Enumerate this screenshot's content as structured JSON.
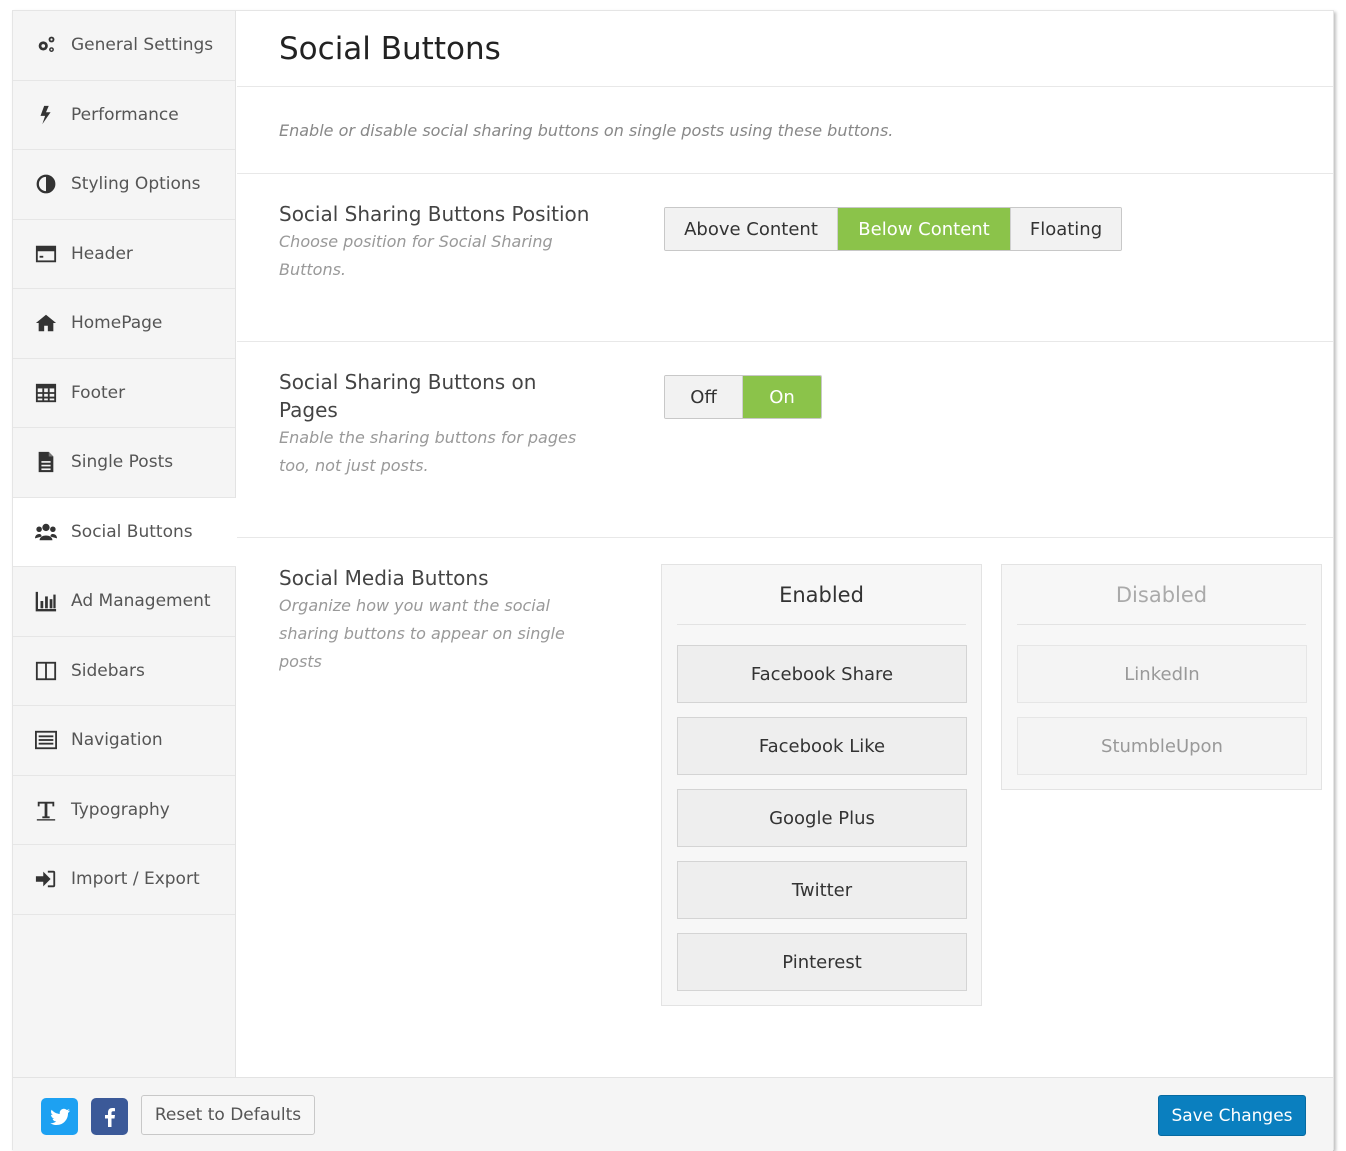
{
  "sidebar": {
    "items": [
      {
        "label": "General Settings",
        "icon": "gears-icon"
      },
      {
        "label": "Performance",
        "icon": "bolt-icon"
      },
      {
        "label": "Styling Options",
        "icon": "contrast-icon"
      },
      {
        "label": "Header",
        "icon": "header-icon"
      },
      {
        "label": "HomePage",
        "icon": "home-icon"
      },
      {
        "label": "Footer",
        "icon": "table-icon"
      },
      {
        "label": "Single Posts",
        "icon": "document-icon"
      },
      {
        "label": "Social Buttons",
        "icon": "users-icon",
        "active": true
      },
      {
        "label": "Ad Management",
        "icon": "bar-chart-icon"
      },
      {
        "label": "Sidebars",
        "icon": "columns-icon"
      },
      {
        "label": "Navigation",
        "icon": "list-icon"
      },
      {
        "label": "Typography",
        "icon": "text-icon"
      },
      {
        "label": "Import / Export",
        "icon": "sign-in-icon"
      }
    ]
  },
  "main": {
    "title": "Social Buttons",
    "description": "Enable or disable social sharing buttons on single posts using these buttons.",
    "position": {
      "label": "Social Sharing Buttons Position",
      "sublabel": "Choose position for Social Sharing Buttons.",
      "options": [
        "Above Content",
        "Below Content",
        "Floating"
      ],
      "selected": "Below Content"
    },
    "pages": {
      "label": "Social Sharing Buttons on Pages",
      "sublabel": "Enable the sharing buttons for pages too, not just posts.",
      "off_label": "Off",
      "on_label": "On",
      "selected": "On"
    },
    "media": {
      "label": "Social Media Buttons",
      "sublabel": "Organize how you want the social sharing buttons to appear on single posts",
      "enabled_title": "Enabled",
      "enabled": [
        "Facebook Share",
        "Facebook Like",
        "Google Plus",
        "Twitter",
        "Pinterest"
      ],
      "disabled_title": "Disabled",
      "disabled": [
        "LinkedIn",
        "StumbleUpon"
      ]
    }
  },
  "footer": {
    "reset_label": "Reset to Defaults",
    "save_label": "Save Changes"
  },
  "colors": {
    "accent_green": "#8bc34a",
    "save_blue": "#0a7fbf",
    "twitter_blue": "#1da1f2",
    "facebook_blue": "#3b5998"
  }
}
